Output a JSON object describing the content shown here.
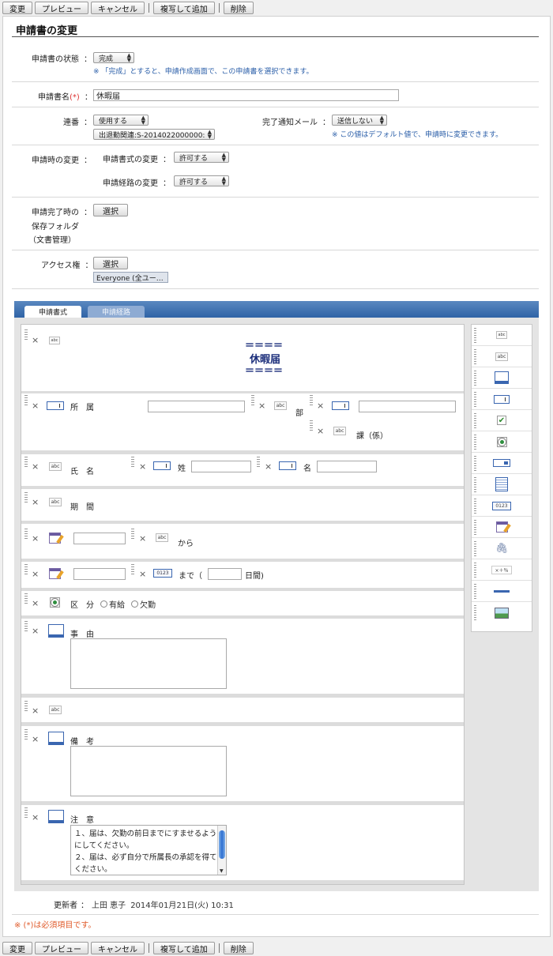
{
  "toolbar": {
    "change": "変更",
    "preview": "プレビュー",
    "cancel": "キャンセル",
    "copy_add": "複写して追加",
    "delete": "削除",
    "separator": "|"
  },
  "page": {
    "title": "申請書の変更"
  },
  "fields": {
    "status": {
      "label": "申請書の状態",
      "colon": "：",
      "value": "完成",
      "note": "※ 「完成」とすると、申請作成画面で、この申請書を選択できます。"
    },
    "name": {
      "label": "申請書名",
      "req": "(*)",
      "colon": "：",
      "value": "休暇届"
    },
    "renban": {
      "label": "連番",
      "colon": "：",
      "value": "使用する",
      "value2": "出退勤関連:S-2014022000000:"
    },
    "mail": {
      "label": "完了通知メール",
      "colon": "：",
      "value": "送信しない",
      "note": "※ この値はデフォルト値で、申請時に変更できます。"
    },
    "change": {
      "label": "申請時の変更",
      "colon": "：",
      "form_label": "申請書式の変更",
      "form_value": "許可する",
      "route_label": "申請経路の変更",
      "route_value": "許可する"
    },
    "folder": {
      "label1": "申請完了時の",
      "label2": "保存フォルダ",
      "label3": "（文書管理）",
      "colon": "：",
      "button": "選択"
    },
    "access": {
      "label": "アクセス権",
      "colon": "：",
      "button": "選択",
      "value": "Everyone (全ユー…"
    }
  },
  "tabs": {
    "form": "申請書式",
    "route": "申請経路"
  },
  "form": {
    "delete_icon": "×",
    "title_lines": [
      "＝＝＝＝",
      "休暇届",
      "＝＝＝＝"
    ],
    "shozoku": "所　属",
    "bu": "部",
    "ka": "課（係）",
    "shimei": "氏　名",
    "sei": "姓",
    "mei": "名",
    "kikan": "期　間",
    "kara": "から",
    "made": "まで（",
    "nichikan": "日間)",
    "kubun": "区　分",
    "yukyu": "有給",
    "kekkin": "欠勤",
    "jiyu": "事　由",
    "biko": "備　考",
    "chui": "注　意",
    "chui_text": "１、届は、欠勤の前日までにすませるようにしてください。\n２、届は、必ず自分で所属長の承認を得てください。"
  },
  "icons": {
    "abc": "abc",
    "label_icon": "abc",
    "n0123": "0123",
    "calc": "×＋％",
    "check": "✔",
    "clip": "🖇"
  },
  "footer": {
    "updater_label": "更新者",
    "colon": "：",
    "updater_name": "上田 恵子",
    "updated_at": "2014年01月21日(火) 10:31",
    "required_note": "※ (*)は必須項目です。"
  }
}
